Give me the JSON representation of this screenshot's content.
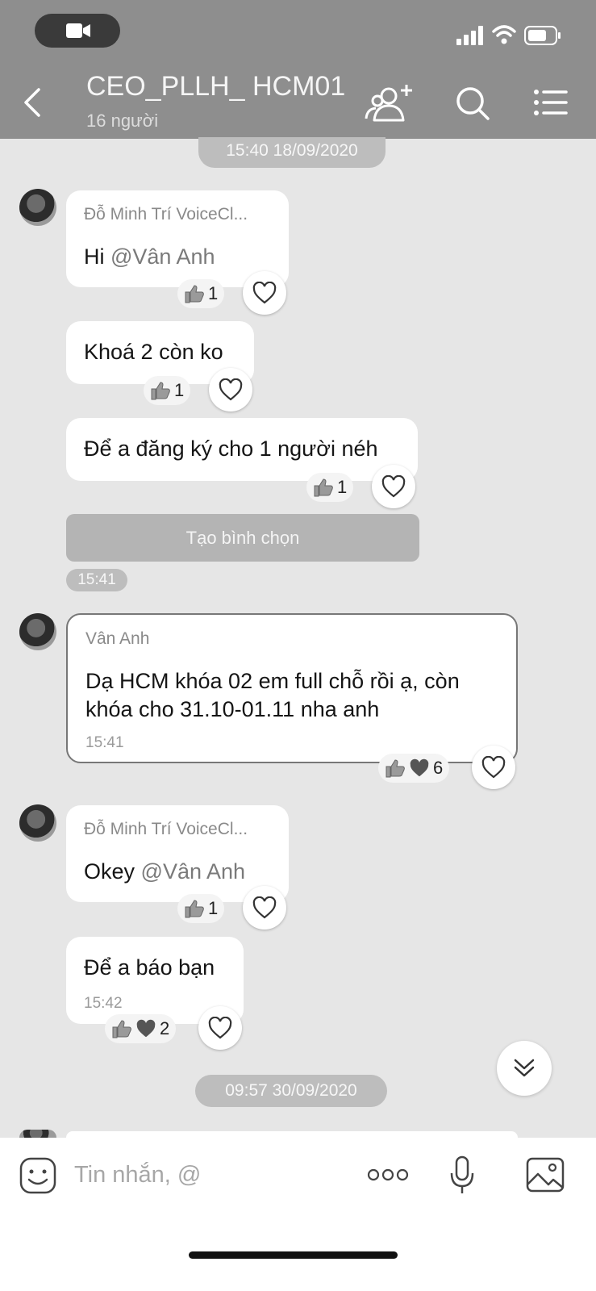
{
  "header": {
    "title": "CEO_PLLH_ HCM01",
    "subtitle": "16 người"
  },
  "chips": {
    "date1": "15:40 18/09/2020",
    "time1": "15:41",
    "date2": "09:57 30/09/2020"
  },
  "messages": [
    {
      "sender": "Đỗ Minh Trí  VoiceCl...",
      "text": "Hi ",
      "mention": "@Vân Anh",
      "likes": "1"
    },
    {
      "text": "Khoá 2 còn ko",
      "likes": "1"
    },
    {
      "text": "Để a đăng ký cho 1 người néh",
      "likes": "1"
    },
    {
      "sender": "Vân Anh",
      "line1": "Dạ HCM khóa 02 em full chỗ rồi ạ, còn",
      "line2": "khóa cho 31.10-01.11 nha anh",
      "time": "15:41",
      "likes": "6"
    },
    {
      "sender": "Đỗ Minh Trí  VoiceCl...",
      "text": "Okey ",
      "mention": "@Vân Anh",
      "likes": "1"
    },
    {
      "text": "Để a báo bạn",
      "time": "15:42",
      "likes": "2"
    }
  ],
  "poll_button": "Tạo bình chọn",
  "composer": {
    "placeholder": "Tin nhắn, @"
  },
  "icons": [
    "back-icon",
    "video-icon",
    "signal-icon",
    "wifi-icon",
    "battery-icon",
    "add-member-icon",
    "search-icon",
    "menu-icon",
    "thumbs-up-icon",
    "heart-icon",
    "emoji-icon",
    "more-icon",
    "microphone-icon",
    "image-icon",
    "chevron-double-down-icon"
  ]
}
